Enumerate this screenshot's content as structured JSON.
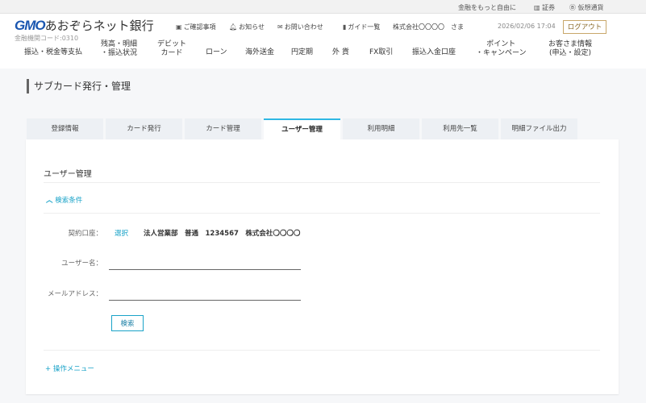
{
  "topbar": {
    "tagline": "金融をもっと自由に",
    "securities": "証券",
    "crypto": "仮想通貨"
  },
  "header": {
    "logo_brand": "GMO",
    "logo_text": "あおぞらネット銀行",
    "bank_code": "金融機関コード:0310",
    "confirm": "ご確認事項",
    "notice": "お知らせ",
    "contact": "お問い合わせ",
    "guide": "ガイド一覧",
    "user": "株式会社〇〇〇〇　さま",
    "datetime": "2026/02/06 17:04",
    "logout": "ログアウト"
  },
  "nav": [
    "振込・税金等支払",
    "残高・明細\n・振込状況",
    "デビット\nカード",
    "ローン",
    "海外送金",
    "円定期",
    "外 貨",
    "FX取引",
    "振込入金口座",
    "ポイント\n・キャンペーン",
    "お客さま情報\n(申込・設定)"
  ],
  "page_title": "サブカード発行・管理",
  "tabs": [
    "登録情報",
    "カード発行",
    "カード管理",
    "ユーザー管理",
    "利用明細",
    "利用先一覧",
    "明細ファイル出力"
  ],
  "panel": {
    "title": "ユーザー管理",
    "search_toggle": "検索条件",
    "account_label": "契約口座：",
    "select_link": "選択",
    "account_value": "法人営業部　普通　1234567　株式会社〇〇〇〇",
    "username_label": "ユーザー名：",
    "username_value": "",
    "email_label": "メールアドレス：",
    "email_value": "",
    "search_button": "検索",
    "op_menu": "操作メニュー"
  }
}
